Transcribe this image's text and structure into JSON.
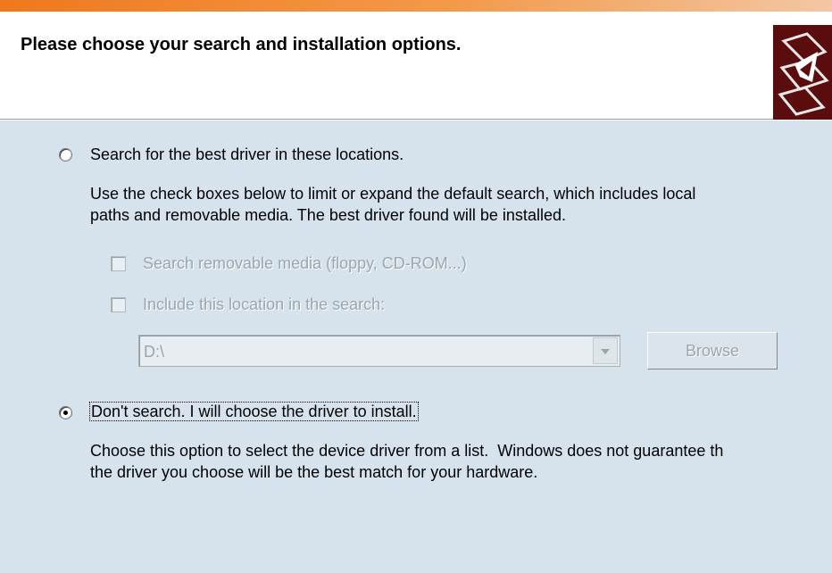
{
  "header": {
    "title": "Please choose your search and installation options.",
    "icon": "hardware-wizard-icon"
  },
  "options": {
    "search": {
      "label": "Search for the best driver in these locations.",
      "selected": false,
      "description": "Use the check boxes below to limit or expand the default search, which includes local\npaths and removable media. The best driver found will be installed.",
      "removable_media": {
        "label": "Search removable media (floppy, CD-ROM...)",
        "checked": false,
        "enabled": false
      },
      "include_location": {
        "label": "Include this location in the search:",
        "checked": false,
        "enabled": false
      },
      "location_value": "D:\\",
      "browse_label": "Browse"
    },
    "dont_search": {
      "label": "Don't search. I will choose the driver to install.",
      "selected": true,
      "description": "Choose this option to select the device driver from a list.  Windows does not guarantee th\nthe driver you choose will be the best match for your hardware."
    }
  },
  "colors": {
    "title_bar": "#f0781c",
    "panel_background": "#d6e3ed",
    "header_background": "#ffffff",
    "disabled_text": "#9aa5ae"
  }
}
